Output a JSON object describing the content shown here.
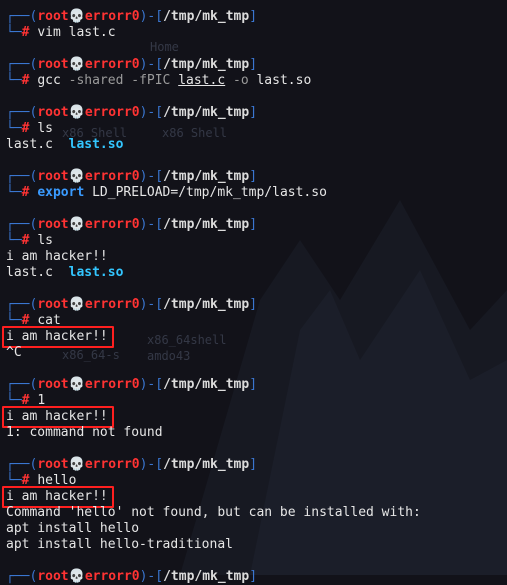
{
  "prompt": {
    "user": "root",
    "skull": "💀",
    "host": "errorr0",
    "dir": "/tmp/mk_tmp",
    "open": "┌──(",
    "close": ")-[",
    "end": "]",
    "hash_prefix": "└─",
    "hash": "#"
  },
  "blocks": [
    {
      "cmd_parts": [
        {
          "t": "vim last.c",
          "c": "cmd"
        }
      ],
      "output": []
    },
    {
      "cmd_parts": [
        {
          "t": "gcc ",
          "c": "cmd"
        },
        {
          "t": "-shared -fPIC ",
          "c": "opt"
        },
        {
          "t": "last.c",
          "c": "cmd ul"
        },
        {
          "t": " -o ",
          "c": "opt"
        },
        {
          "t": "last.so",
          "c": "cmd"
        }
      ],
      "output": []
    },
    {
      "cmd_parts": [
        {
          "t": "ls",
          "c": "cmd"
        }
      ],
      "output": [
        [
          {
            "t": "last.c  ",
            "c": "cmd"
          },
          {
            "t": "last.so",
            "c": "green-b"
          }
        ]
      ]
    },
    {
      "cmd_parts": [
        {
          "t": "export",
          "c": "kw"
        },
        {
          "t": " LD_PRELOAD=/tmp/mk_tmp/last.so",
          "c": "cmd"
        }
      ],
      "output": []
    },
    {
      "cmd_parts": [
        {
          "t": "ls",
          "c": "cmd"
        }
      ],
      "output": [
        [
          {
            "t": "i am hacker!!",
            "c": "cmd"
          }
        ],
        [
          {
            "t": "last.c  ",
            "c": "cmd"
          },
          {
            "t": "last.so",
            "c": "green-b"
          }
        ]
      ]
    },
    {
      "cmd_parts": [
        {
          "t": "cat",
          "c": "cmd"
        }
      ],
      "output": [
        [
          {
            "t": "i am hacker!!",
            "c": "cmd",
            "box": true
          }
        ],
        [
          {
            "t": "^C",
            "c": "cmd"
          }
        ]
      ]
    },
    {
      "cmd_parts": [
        {
          "t": "1",
          "c": "cmd"
        }
      ],
      "output": [
        [
          {
            "t": "i am hacker!!",
            "c": "cmd",
            "box": true
          }
        ],
        [
          {
            "t": "1: command not found",
            "c": "cmd"
          }
        ]
      ]
    },
    {
      "cmd_parts": [
        {
          "t": "hello",
          "c": "cmd"
        }
      ],
      "output": [
        [
          {
            "t": "i am hacker!!",
            "c": "cmd",
            "box": true
          }
        ],
        [
          {
            "t": "Command 'hello' not found, but can be installed with:",
            "c": "cmd"
          }
        ],
        [
          {
            "t": "apt install hello",
            "c": "cmd"
          }
        ],
        [
          {
            "t": "apt install hello-traditional",
            "c": "cmd"
          }
        ]
      ]
    },
    {
      "cmd_parts": null,
      "output": []
    }
  ],
  "desktop_ghost_labels": [
    "Home",
    "x86 Shell",
    "x86 Shell",
    "x86_64-s",
    "x86_64shell",
    "amdo43"
  ],
  "colors": {
    "bg": "#121219",
    "prompt_line": "#3a76d0",
    "user_host": "#ff3333",
    "highlight_box": "#ff1f1f"
  }
}
